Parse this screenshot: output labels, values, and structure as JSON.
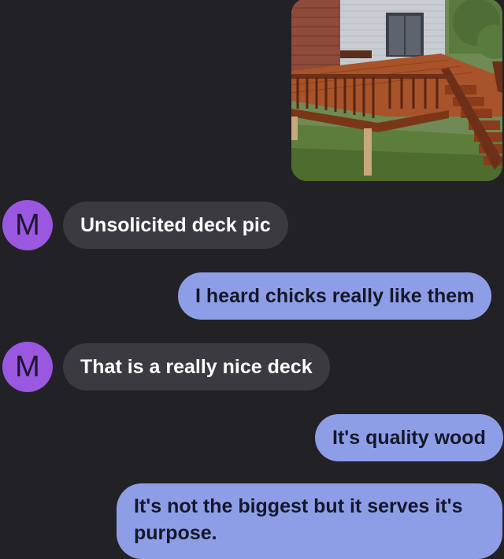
{
  "messages": {
    "photo": {
      "icon": "deck-photo"
    },
    "m1": {
      "avatar_letter": "M",
      "text": "Unsolicited deck pic"
    },
    "m2": {
      "text": "I heard chicks really like them"
    },
    "m3": {
      "avatar_letter": "M",
      "text": "That is a really nice deck"
    },
    "m4": {
      "text": "It's quality wood"
    },
    "m5": {
      "text": "It's not the biggest but it serves it's purpose."
    }
  },
  "colors": {
    "background": "#222125",
    "incoming_bubble": "#3b3a40",
    "outgoing_bubble": "#8e9ee6",
    "avatar": "#9a57e0"
  }
}
